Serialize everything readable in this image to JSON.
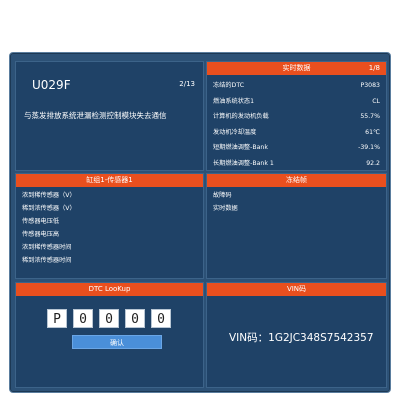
{
  "dtc": {
    "code": "U029F",
    "page": "2/13",
    "description": "与蒸发排放系统泄漏检测控制模块失去通信"
  },
  "live_data": {
    "title": "实时数据",
    "page": "1/8",
    "items": [
      {
        "label": "冻结的DTC",
        "value": "P3083"
      },
      {
        "label": "燃油系统状态1",
        "value": "CL"
      },
      {
        "label": "计算机的发动机负载",
        "value": "55.7%"
      },
      {
        "label": "发动机冷却温度",
        "value": "61℃"
      },
      {
        "label": "短期燃油调整-Bank",
        "value": "-39.1%"
      },
      {
        "label": "长期燃油调整-Bank 1",
        "value": "92.2"
      }
    ]
  },
  "sensor": {
    "title": "缸组1-传感器1",
    "items": [
      "浓到稀传感器（V）",
      "稀到浓传感器（V）",
      "传感器电压低",
      "传感器电压高",
      "浓到稀传感器时间",
      "稀到浓传感器时间"
    ]
  },
  "freeze": {
    "title": "冻结帧",
    "items": [
      "故障码",
      "实时数据"
    ]
  },
  "lookup": {
    "title": "DTC LooKup",
    "chars": [
      "P",
      "0",
      "0",
      "0",
      "0"
    ],
    "confirm_label": "确认"
  },
  "vin": {
    "title": "VIN码",
    "text": "VIN码：1G2JC348S7542357"
  },
  "colors": {
    "accent": "#e94f1e",
    "panel_bg": "#1f4267",
    "frame_bg": "#2c5176",
    "button": "#4a8fd9"
  }
}
